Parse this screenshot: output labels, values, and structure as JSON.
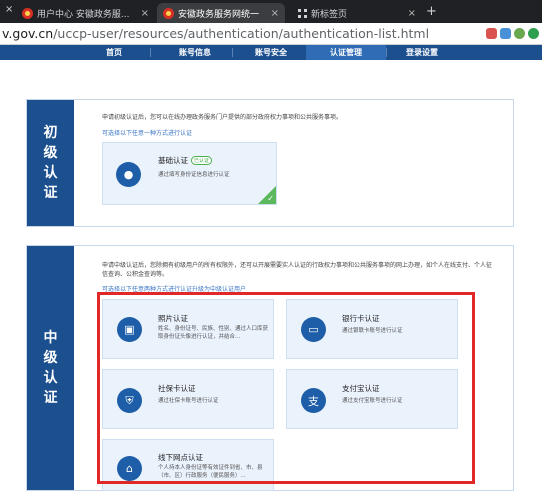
{
  "browser": {
    "left_close": "×",
    "tabs": [
      {
        "title": "用户中心 安徽政务服...",
        "close": "×",
        "active": false
      },
      {
        "title": "安徽政务服务网统一",
        "close": "×",
        "active": true
      },
      {
        "title": "新标签页",
        "close": "×",
        "active": false
      }
    ],
    "new_tab": "+",
    "url_host": "v.gov.cn",
    "url_path": "/uccp-user/resources/authentication/authentication-list.html"
  },
  "nav": {
    "items": [
      "首页",
      "账号信息",
      "账号安全",
      "认证管理",
      "登录设置"
    ],
    "active_index": 3
  },
  "primary": {
    "side_label": [
      "初",
      "级",
      "认",
      "证"
    ],
    "description": "申请初级认证后，您可以在线办理政务服务门户提供的部分政府权力事项和公共服务事项。",
    "link": "可选择以下任意一种方式进行认证",
    "card": {
      "icon": "person-icon",
      "title": "基础认证",
      "badge": "已认证",
      "desc": "通过填写身份证信息进行认证",
      "check": "✓"
    }
  },
  "intermediate": {
    "side_label": [
      "中",
      "级",
      "认",
      "证"
    ],
    "description": "申请中级认证后，您除拥有初级用户的所有权限外，还可以开展需要实人认证的行政权力事项和公共服务事项的网上办理，如个人在线支付、个人征信查询、公积金查询等。",
    "link": "可选择以下任意两种方式进行认证升级为中级认证用户",
    "cards": [
      {
        "icon": "photo-id-icon",
        "title": "照片认证",
        "desc": "姓名、身份证号、民族、性别、通过人口库获取身份证头像进行认证，并结合..."
      },
      {
        "icon": "bank-card-icon",
        "title": "银行卡认证",
        "desc": "通过银联卡账号进行认证"
      },
      {
        "icon": "social-security-icon",
        "title": "社保卡认证",
        "desc": "通过社保卡账号进行认证"
      },
      {
        "icon": "alipay-icon",
        "title": "支付宝认证",
        "desc": "通过支付宝账号进行认证"
      },
      {
        "icon": "offline-outlet-icon",
        "title": "线下网点认证",
        "desc": "个人持本人身份证等有效证件到省、市、县（市、区）行政服务（便民服务）..."
      }
    ]
  },
  "colors": {
    "brand": "#1c4f8e",
    "link": "#3a75c4",
    "highlight_box": "#e02828",
    "verified": "#5cb85c"
  }
}
